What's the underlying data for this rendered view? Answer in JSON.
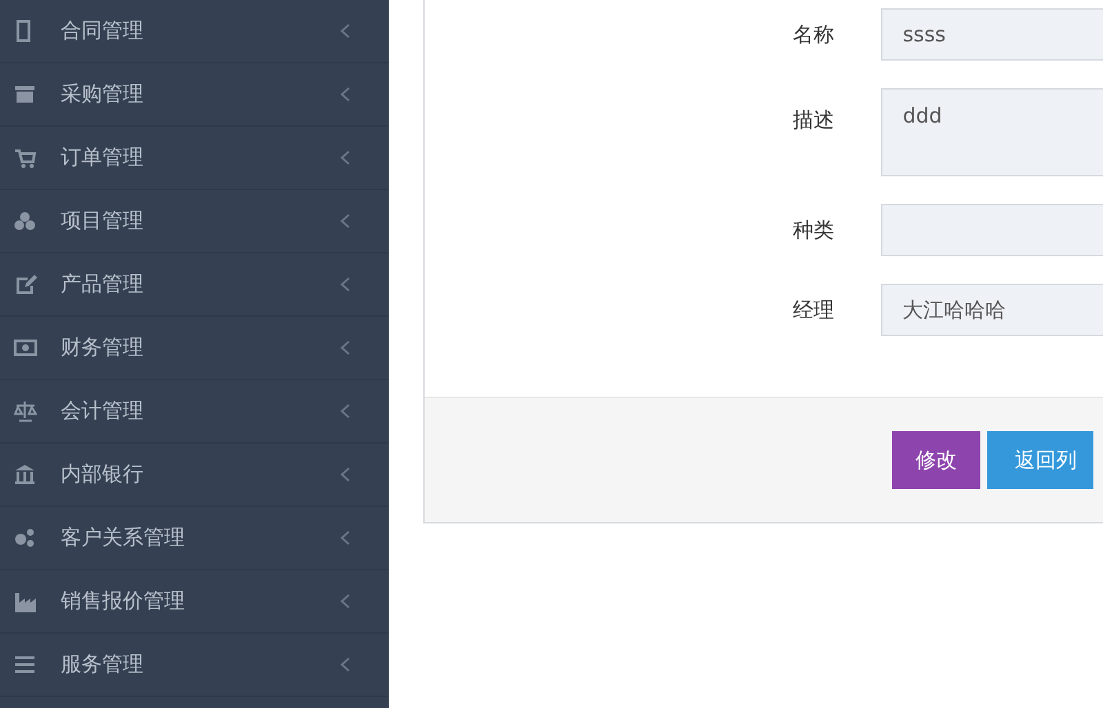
{
  "sidebar": {
    "items": [
      {
        "label": "合同管理",
        "expanded": false
      },
      {
        "label": "采购管理",
        "expanded": false
      },
      {
        "label": "订单管理",
        "expanded": false
      },
      {
        "label": "项目管理",
        "expanded": false
      },
      {
        "label": "产品管理",
        "expanded": false
      },
      {
        "label": "财务管理",
        "expanded": false
      },
      {
        "label": "会计管理",
        "expanded": false
      },
      {
        "label": "内部银行",
        "expanded": false
      },
      {
        "label": "客户关系管理",
        "expanded": false
      },
      {
        "label": "销售报价管理",
        "expanded": false
      },
      {
        "label": "服务管理",
        "expanded": false
      }
    ]
  },
  "form": {
    "fields": [
      {
        "label": "名称",
        "kind": "input",
        "value": "ssss"
      },
      {
        "label": "描述",
        "kind": "textarea",
        "value": "ddd"
      },
      {
        "label": "种类",
        "kind": "input"
      },
      {
        "label": "经理",
        "kind": "input",
        "value": "大江哈哈哈"
      }
    ],
    "buttons": [
      {
        "label": "修改",
        "kind": "primary"
      },
      {
        "label": "返回列",
        "kind": "info"
      }
    ]
  }
}
